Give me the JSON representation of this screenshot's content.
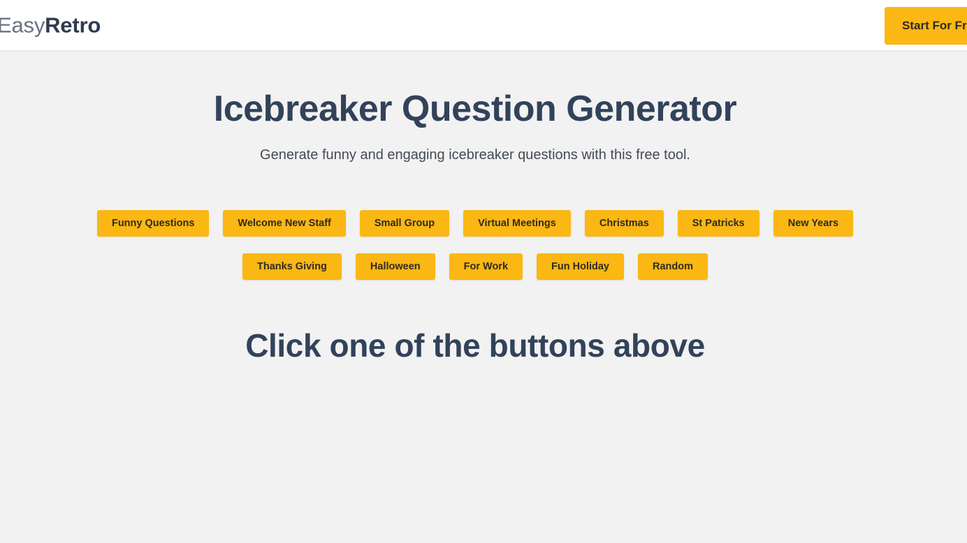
{
  "header": {
    "brand_first": "Easy",
    "brand_second": "Retro",
    "cta_label": "Start For Free"
  },
  "main": {
    "title": "Icebreaker Question Generator",
    "subtitle": "Generate funny and engaging icebreaker questions with this free tool.",
    "result_message": "Click one of the buttons above",
    "topic_rows": [
      [
        {
          "label": "Funny Questions"
        },
        {
          "label": "Welcome New Staff"
        },
        {
          "label": "Small Group"
        },
        {
          "label": "Virtual Meetings"
        },
        {
          "label": "Christmas"
        },
        {
          "label": "St Patricks"
        },
        {
          "label": "New Years"
        }
      ],
      [
        {
          "label": "Thanks Giving"
        },
        {
          "label": "Halloween"
        },
        {
          "label": "For Work"
        },
        {
          "label": "Fun Holiday"
        },
        {
          "label": "Random"
        }
      ]
    ]
  },
  "colors": {
    "accent": "#fbb713",
    "heading": "#32425a",
    "page_background": "#f2f2f2",
    "header_background": "#ffffff",
    "button_text": "#2f2b22"
  }
}
